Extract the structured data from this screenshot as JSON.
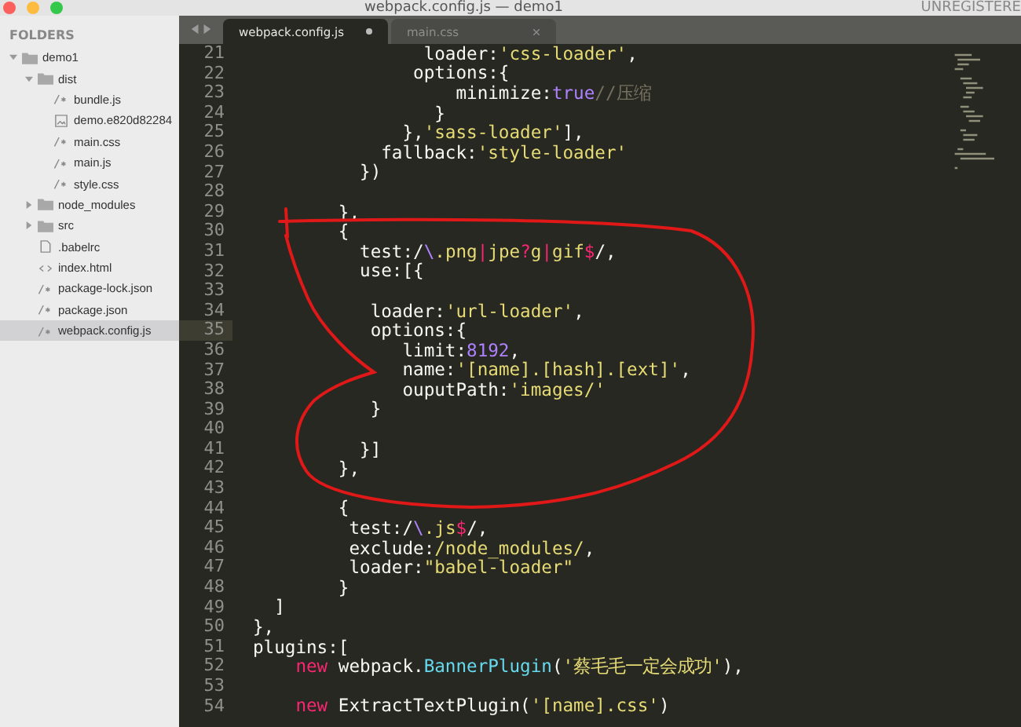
{
  "window": {
    "title": "webpack.config.js — demo1",
    "badge": "UNREGISTERE"
  },
  "sidebar": {
    "heading": "FOLDERS",
    "items": [
      {
        "label": "demo1",
        "kind": "folder",
        "expanded": true,
        "selected": false,
        "children": [
          {
            "label": "dist",
            "kind": "folder",
            "expanded": true,
            "selected": false,
            "children": [
              {
                "label": "bundle.js",
                "kind": "script",
                "selected": false
              },
              {
                "label": "demo.e820d82284",
                "kind": "image",
                "selected": false
              },
              {
                "label": "main.css",
                "kind": "script",
                "selected": false
              },
              {
                "label": "main.js",
                "kind": "script",
                "selected": false
              },
              {
                "label": "style.css",
                "kind": "script",
                "selected": false
              }
            ]
          },
          {
            "label": "node_modules",
            "kind": "folder",
            "expanded": false,
            "selected": false
          },
          {
            "label": "src",
            "kind": "folder",
            "expanded": false,
            "selected": false
          },
          {
            "label": ".babelrc",
            "kind": "plain",
            "selected": false
          },
          {
            "label": "index.html",
            "kind": "markup",
            "selected": false
          },
          {
            "label": "package-lock.json",
            "kind": "script",
            "selected": false
          },
          {
            "label": "package.json",
            "kind": "script",
            "selected": false
          },
          {
            "label": "webpack.config.js",
            "kind": "script",
            "selected": true
          }
        ]
      }
    ]
  },
  "tabs": [
    {
      "label": "webpack.config.js",
      "selected": true,
      "modified": true
    },
    {
      "label": "main.css",
      "selected": false,
      "modified": false
    }
  ],
  "editor": {
    "lines": [
      {
        "n": "21",
        "current": false,
        "s": [
          {
            "kind": "plain",
            "text": "                loader:"
          },
          {
            "kind": "string",
            "text": "'css-loader'"
          },
          {
            "kind": "plain",
            "text": ","
          }
        ]
      },
      {
        "n": "22",
        "current": false,
        "s": [
          {
            "kind": "plain",
            "text": "               options:{"
          }
        ]
      },
      {
        "n": "23",
        "current": false,
        "s": [
          {
            "kind": "plain",
            "text": "                   minimize:"
          },
          {
            "kind": "constant",
            "text": "true"
          },
          {
            "kind": "comment",
            "text": "//压缩"
          }
        ]
      },
      {
        "n": "24",
        "current": false,
        "s": [
          {
            "kind": "plain",
            "text": "                 }"
          }
        ]
      },
      {
        "n": "25",
        "current": false,
        "s": [
          {
            "kind": "plain",
            "text": "              },"
          },
          {
            "kind": "string",
            "text": "'sass-loader'"
          },
          {
            "kind": "plain",
            "text": "],"
          }
        ]
      },
      {
        "n": "26",
        "current": false,
        "s": [
          {
            "kind": "plain",
            "text": "            fallback:"
          },
          {
            "kind": "string",
            "text": "'style-loader'"
          }
        ]
      },
      {
        "n": "27",
        "current": false,
        "s": [
          {
            "kind": "plain",
            "text": "          })"
          }
        ]
      },
      {
        "n": "28",
        "current": false
      },
      {
        "n": "29",
        "current": false,
        "s": [
          {
            "kind": "plain",
            "text": "        },"
          }
        ]
      },
      {
        "n": "30",
        "current": false,
        "s": [
          {
            "kind": "plain",
            "text": "        {"
          }
        ]
      },
      {
        "n": "31",
        "current": false,
        "s": [
          {
            "kind": "plain",
            "text": "          test:/"
          },
          {
            "kind": "constant",
            "text": "\\"
          },
          {
            "kind": "string",
            "text": ".png"
          },
          {
            "kind": "keyword",
            "text": "|"
          },
          {
            "kind": "string",
            "text": "jpe"
          },
          {
            "kind": "keyword",
            "text": "?"
          },
          {
            "kind": "string",
            "text": "g"
          },
          {
            "kind": "keyword",
            "text": "|"
          },
          {
            "kind": "string",
            "text": "gif"
          },
          {
            "kind": "keyword",
            "text": "$"
          },
          {
            "kind": "plain",
            "text": "/,"
          }
        ]
      },
      {
        "n": "32",
        "current": false,
        "s": [
          {
            "kind": "plain",
            "text": "          use:[{"
          }
        ]
      },
      {
        "n": "33",
        "current": false
      },
      {
        "n": "34",
        "current": false,
        "s": [
          {
            "kind": "plain",
            "text": "           loader:"
          },
          {
            "kind": "string",
            "text": "'url-loader'"
          },
          {
            "kind": "plain",
            "text": ","
          }
        ]
      },
      {
        "n": "35",
        "current": true,
        "s": [
          {
            "kind": "plain",
            "text": "           options:{"
          }
        ]
      },
      {
        "n": "36",
        "current": false,
        "s": [
          {
            "kind": "plain",
            "text": "              limit:"
          },
          {
            "kind": "constant",
            "text": "8192"
          },
          {
            "kind": "plain",
            "text": ","
          }
        ]
      },
      {
        "n": "37",
        "current": false,
        "s": [
          {
            "kind": "plain",
            "text": "              name:"
          },
          {
            "kind": "string",
            "text": "'[name].[hash].[ext]'"
          },
          {
            "kind": "plain",
            "text": ","
          }
        ]
      },
      {
        "n": "38",
        "current": false,
        "s": [
          {
            "kind": "plain",
            "text": "              ouputPath:"
          },
          {
            "kind": "string",
            "text": "'images/'"
          }
        ]
      },
      {
        "n": "39",
        "current": false,
        "s": [
          {
            "kind": "plain",
            "text": "           }"
          }
        ]
      },
      {
        "n": "40",
        "current": false
      },
      {
        "n": "41",
        "current": false,
        "s": [
          {
            "kind": "plain",
            "text": "          }]"
          }
        ]
      },
      {
        "n": "42",
        "current": false,
        "s": [
          {
            "kind": "plain",
            "text": "        },"
          }
        ]
      },
      {
        "n": "43",
        "current": false
      },
      {
        "n": "44",
        "current": false,
        "s": [
          {
            "kind": "plain",
            "text": "        {"
          }
        ]
      },
      {
        "n": "45",
        "current": false,
        "s": [
          {
            "kind": "plain",
            "text": "         test:/"
          },
          {
            "kind": "constant",
            "text": "\\"
          },
          {
            "kind": "string",
            "text": ".js"
          },
          {
            "kind": "keyword",
            "text": "$"
          },
          {
            "kind": "plain",
            "text": "/,"
          }
        ]
      },
      {
        "n": "46",
        "current": false,
        "s": [
          {
            "kind": "plain",
            "text": "         exclude:"
          },
          {
            "kind": "string",
            "text": "/node_modules/"
          },
          {
            "kind": "plain",
            "text": ","
          }
        ]
      },
      {
        "n": "47",
        "current": false,
        "s": [
          {
            "kind": "plain",
            "text": "         loader:"
          },
          {
            "kind": "string",
            "text": "\"babel-loader\""
          }
        ]
      },
      {
        "n": "48",
        "current": false,
        "s": [
          {
            "kind": "plain",
            "text": "        }"
          }
        ]
      },
      {
        "n": "49",
        "current": false,
        "s": [
          {
            "kind": "plain",
            "text": "  ]"
          }
        ]
      },
      {
        "n": "50",
        "current": false,
        "s": [
          {
            "kind": "plain",
            "text": "},"
          }
        ]
      },
      {
        "n": "51",
        "current": false,
        "s": [
          {
            "kind": "plain",
            "text": "plugins:["
          }
        ]
      },
      {
        "n": "52",
        "current": false,
        "s": [
          {
            "kind": "keyword",
            "text": "    new"
          },
          {
            "kind": "plain",
            "text": " webpack."
          },
          {
            "kind": "function",
            "text": "BannerPlugin"
          },
          {
            "kind": "plain",
            "text": "("
          },
          {
            "kind": "string",
            "text": "'蔡毛毛一定会成功'"
          },
          {
            "kind": "plain",
            "text": "),"
          }
        ]
      },
      {
        "n": "53",
        "current": false
      },
      {
        "n": "54",
        "current": false,
        "s": [
          {
            "kind": "keyword",
            "text": "    new"
          },
          {
            "kind": "plain",
            "text": " ExtractTextPlugin("
          },
          {
            "kind": "string",
            "text": "'[name].css'"
          },
          {
            "kind": "plain",
            "text": ")"
          }
        ]
      }
    ]
  },
  "annotation": {
    "kind": "freehand-loop"
  }
}
